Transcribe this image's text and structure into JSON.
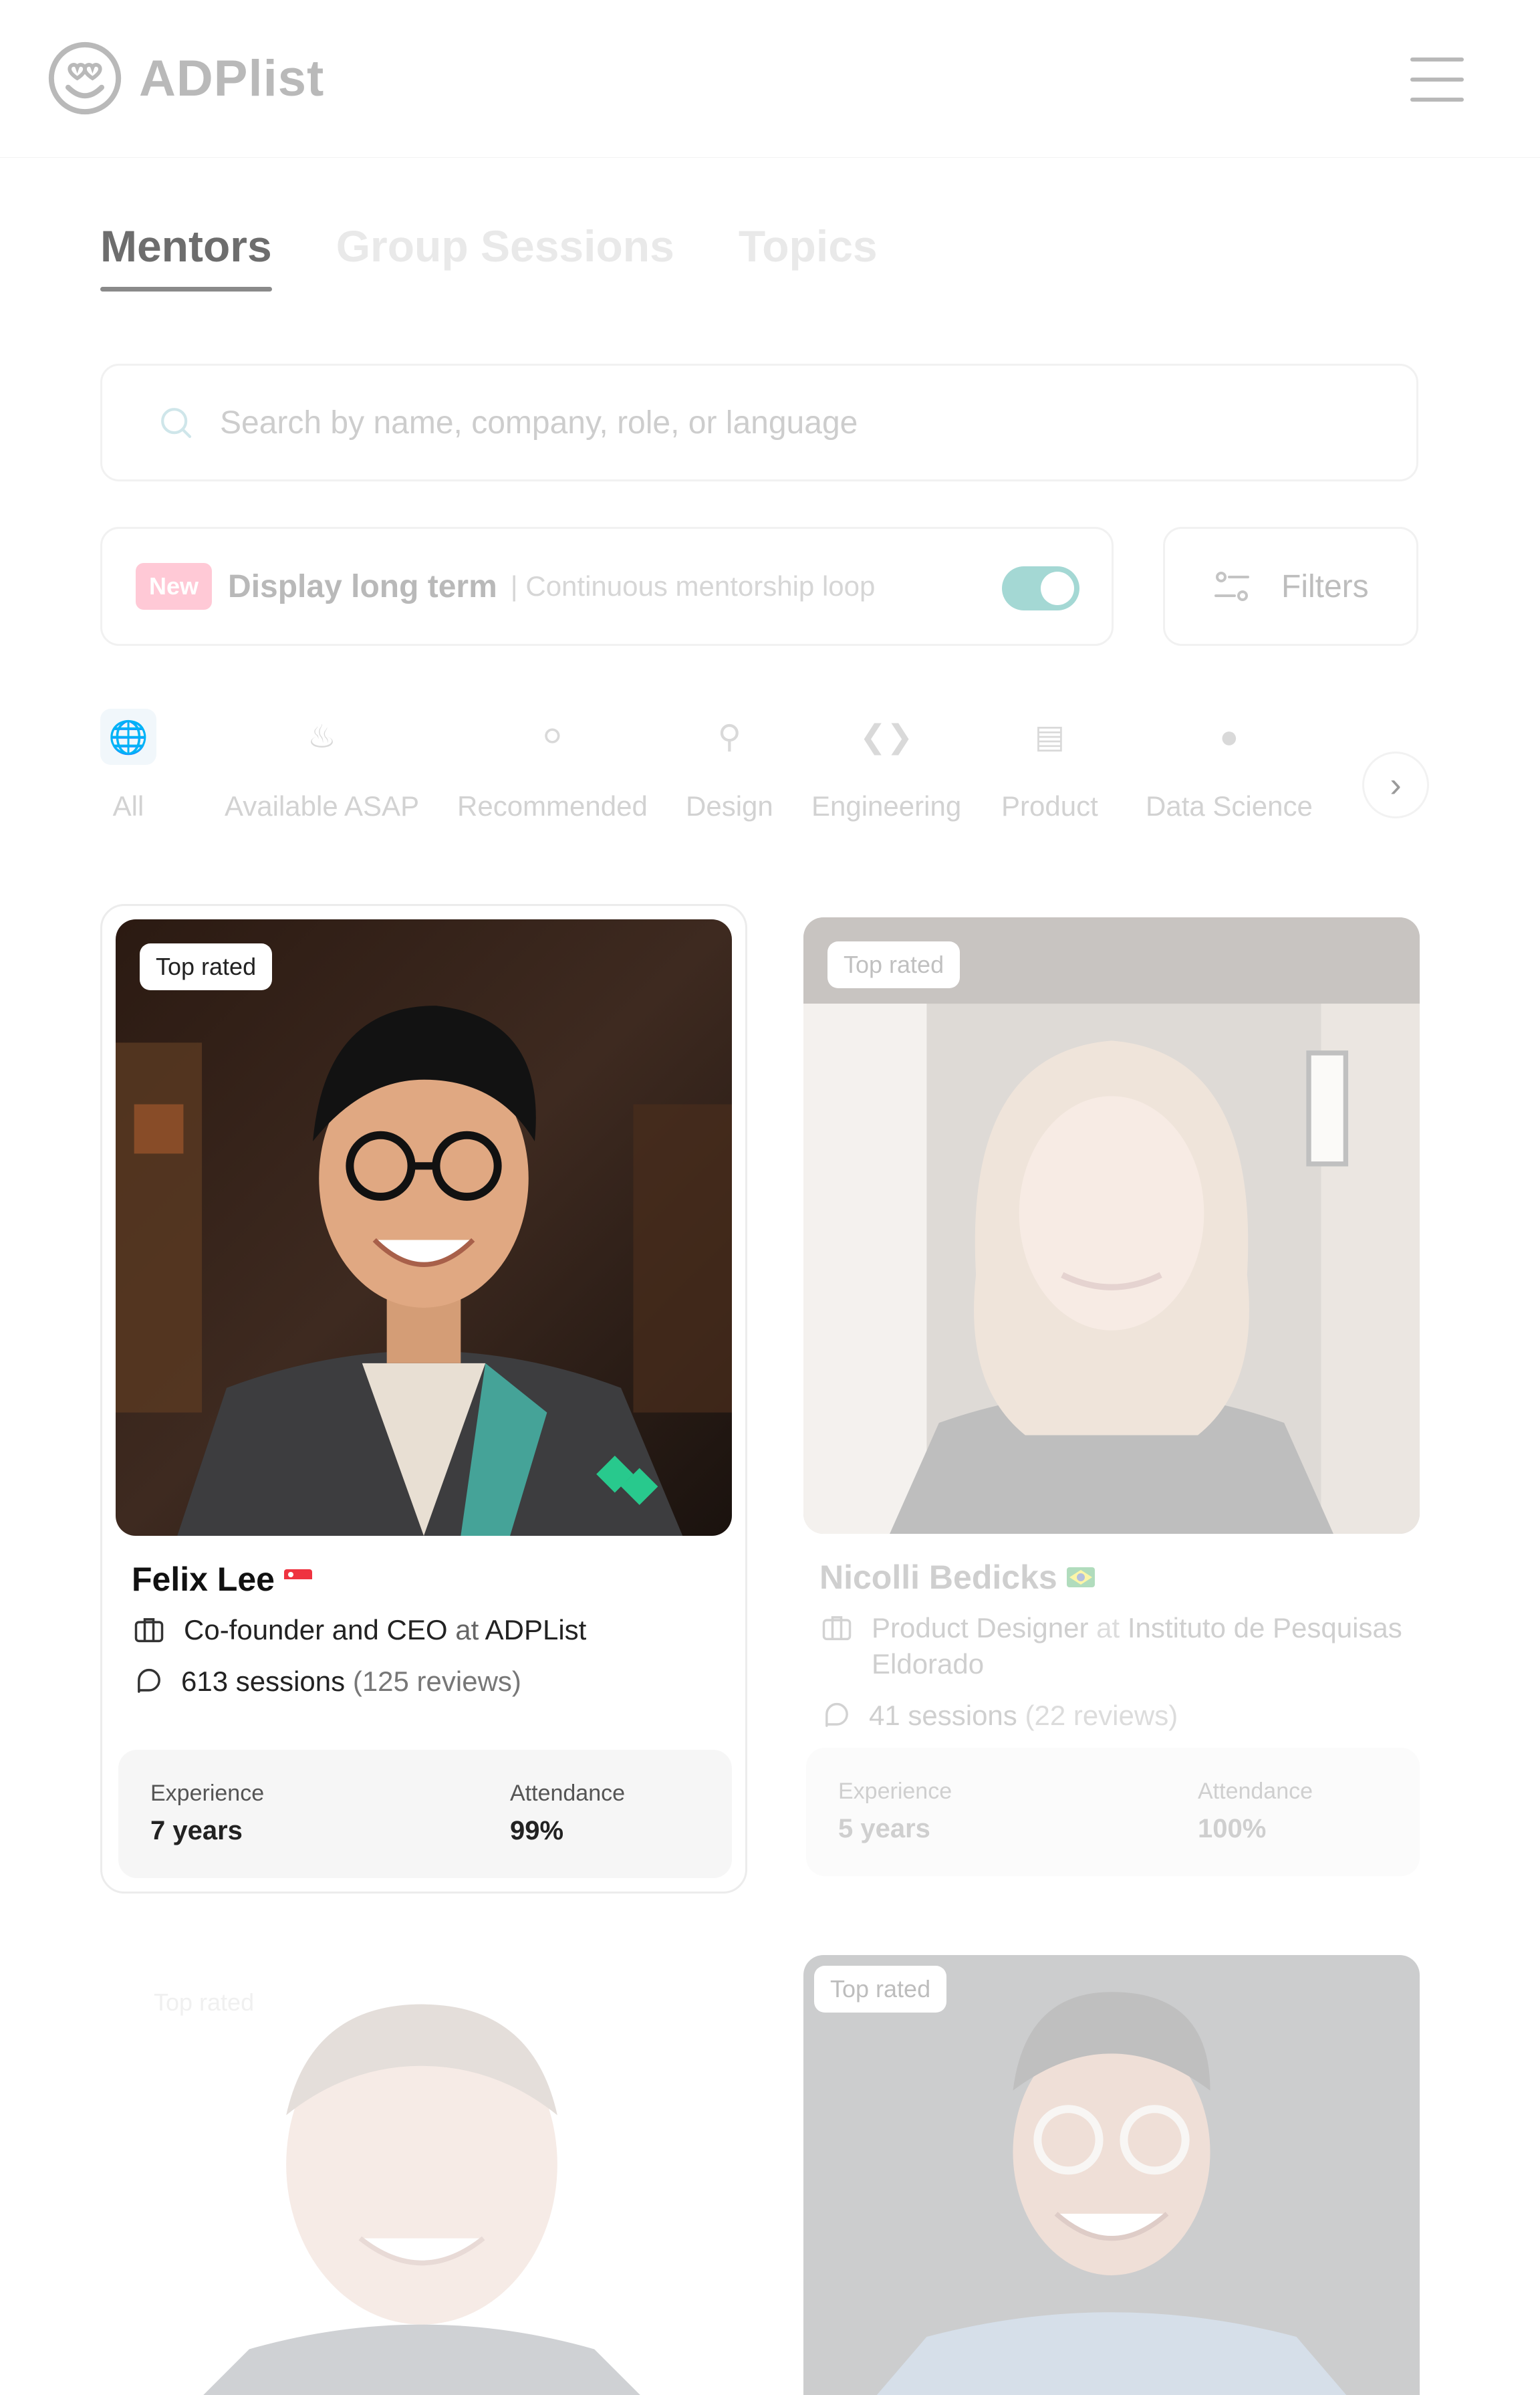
{
  "header": {
    "logo_text": "ADPlist",
    "logo_icon": "smiley-heart-eyes-icon",
    "menu_icon": "hamburger-menu-icon"
  },
  "tabs": [
    {
      "label": "Mentors",
      "active": true
    },
    {
      "label": "Group Sessions",
      "active": false
    },
    {
      "label": "Topics",
      "active": false
    }
  ],
  "search": {
    "placeholder": "Search by name, company, role, or language"
  },
  "long_term": {
    "badge": "New",
    "title": "Display long term",
    "subtitle": "| Continuous mentorship loop",
    "toggle_on": true
  },
  "filters": {
    "label": "Filters"
  },
  "categories": [
    {
      "label": "All",
      "selected": true
    },
    {
      "label": "Available ASAP",
      "selected": false
    },
    {
      "label": "Recommended",
      "selected": false
    },
    {
      "label": "Design",
      "selected": false
    },
    {
      "label": "Engineering",
      "selected": false
    },
    {
      "label": "Product",
      "selected": false
    },
    {
      "label": "Data Science",
      "selected": false
    }
  ],
  "mentors": [
    {
      "badge": "Top rated",
      "name": "Felix Lee",
      "role": "Co-founder and CEO",
      "at": "at",
      "company": "ADPList",
      "sessions": "613 sessions",
      "reviews": "(125 reviews)",
      "experience_label": "Experience",
      "experience_value": "7 years",
      "attendance_label": "Attendance",
      "attendance_value": "99%"
    },
    {
      "badge": "Top rated",
      "name": "Nicolli Bedicks",
      "role": "Product Designer",
      "at": "at",
      "company": "Instituto de Pesquisas Eldorado",
      "sessions": "41 sessions",
      "reviews": "(22 reviews)",
      "experience_label": "Experience",
      "experience_value": "5 years",
      "attendance_label": "Attendance",
      "attendance_value": "100%"
    },
    {
      "badge": "Top rated"
    },
    {
      "badge": "Top rated"
    }
  ],
  "colors": {
    "accent_toggle": "#a4d8d4",
    "badge_new": "#ffc9d6",
    "card_border": "#ececec"
  }
}
